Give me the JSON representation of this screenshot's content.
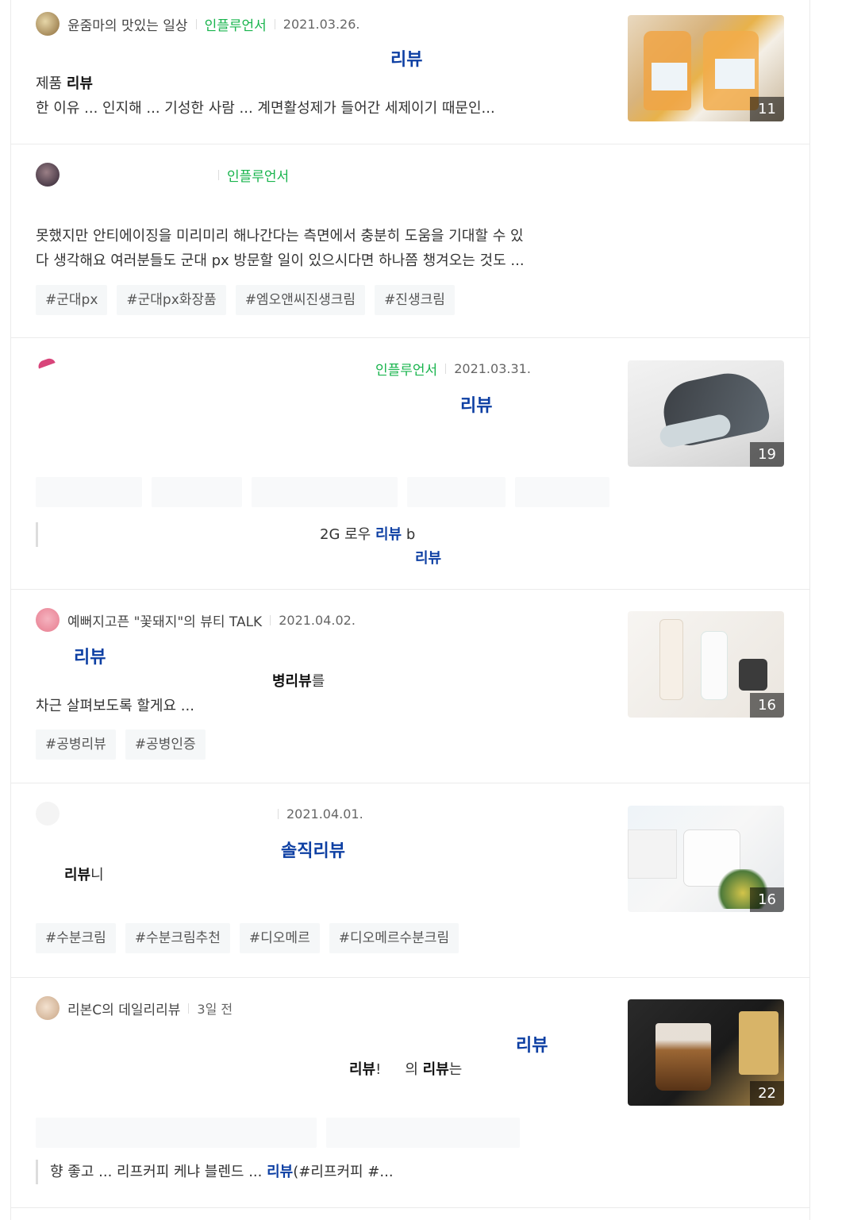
{
  "posts": [
    {
      "blog": "윤줌마의 맛있는 일상",
      "badge": "인플루언서",
      "date": "2021.03.26.",
      "title": "리뷰",
      "line1_a": "제품 ",
      "line1_b": "리뷰",
      "line1_c": "",
      "line2": "한 이유 ... 인지해 ... 기성한 사람 ... 계면활성제가 들어간 세제이기 때문인...",
      "count": "11",
      "tags": []
    },
    {
      "blog": "",
      "badge": "인플루언서",
      "date": "",
      "title": "",
      "line1_a": "못했지만 안티에이징을 미리미리 해나간다는 측면에서 충분히 도움을 기대할 수 있",
      "line1_b": "",
      "line1_c": "",
      "line2": "다 생각해요 여러분들도 군대 px 방문할 일이 있으시다면 하나쯤 챙겨오는 것도 ...",
      "count": "",
      "tags": [
        "#군대px",
        "#군대px화장품",
        "#엠오앤씨진생크림",
        "#진생크림"
      ]
    },
    {
      "blog": "",
      "badge": "인플루언서",
      "date": "2021.03.31.",
      "title": "리뷰",
      "line1_a": "",
      "line1_b": "",
      "line1_c": "",
      "line2": "",
      "count": "19",
      "tags": [],
      "quote1_a": "2G 로우 ",
      "quote1_b": "리뷰",
      "quote1_c": " b",
      "quote2": "리뷰"
    },
    {
      "blog": "예뻐지고픈 \"꽃돼지\"의 뷰티 TALK",
      "badge": "",
      "date": "2021.04.02.",
      "title": "리뷰",
      "line1_a": "",
      "line1_b": "병리뷰",
      "line1_c": "를",
      "line2": "차근 살펴보도록 할게요 ... ",
      "count": "16",
      "tags": [
        "#공병리뷰",
        "#공병인증"
      ]
    },
    {
      "blog": "",
      "badge": "",
      "date": "2021.04.01.",
      "title": "솔직리뷰",
      "line1_a": "",
      "line1_b": "리뷰",
      "line1_c": "니",
      "line2": "",
      "count": "16",
      "tags": [
        "#수분크림",
        "#수분크림추천",
        "#디오메르",
        "#디오메르수분크림"
      ]
    },
    {
      "blog": "리본C의 데일리리뷰",
      "badge": "",
      "date": "3일 전",
      "title": "리뷰",
      "line1_a": "",
      "line1_b": "리뷰",
      "line1_c": "!",
      "line1_d": "의 ",
      "line1_e": "리뷰",
      "line1_f": "는",
      "line2": "",
      "count": "22",
      "tags": [],
      "quote1_a": "향 좋고 ... 리프커피 케냐 블렌드 ... ",
      "quote1_b": "리뷰",
      "quote1_c": "(#리프커피 #..."
    }
  ],
  "colors": {
    "title": "#0d3fa3",
    "influencer": "#19b44d",
    "tag_bg": "#f5f7f8"
  }
}
